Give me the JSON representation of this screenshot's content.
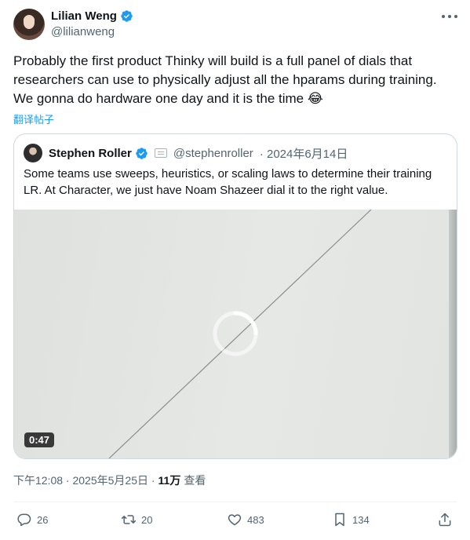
{
  "author": {
    "name": "Lilian Weng",
    "handle": "@lilianweng",
    "avatar_icon": "avatar",
    "verified_icon": "verified-badge-icon"
  },
  "tweet": {
    "text": "Probably the first product Thinky will build is a full panel of dials that researchers can use to physically adjust all the hparams during training. We gonna do hardware one day and it is the time 😂",
    "translate_label": "翻译帖子"
  },
  "quoted": {
    "name": "Stephen Roller",
    "handle": "@stephenroller",
    "date": "· 2024年6月14日",
    "text": "Some teams use sweeps, heuristics, or scaling laws to determine their training LR. At Character, we just have Noam Shazeer dial it to the right value.",
    "video_duration": "0:47"
  },
  "meta": {
    "time": "下午12:08 · 2025年5月25日 ·",
    "views_count": "11万",
    "views_label": "查看"
  },
  "actions": {
    "replies": "26",
    "reposts": "20",
    "likes": "483",
    "bookmarks": "134"
  },
  "colors": {
    "accent": "#1d9bf0",
    "text": "#0f1419",
    "muted": "#536471",
    "border": "#cfd9de"
  }
}
